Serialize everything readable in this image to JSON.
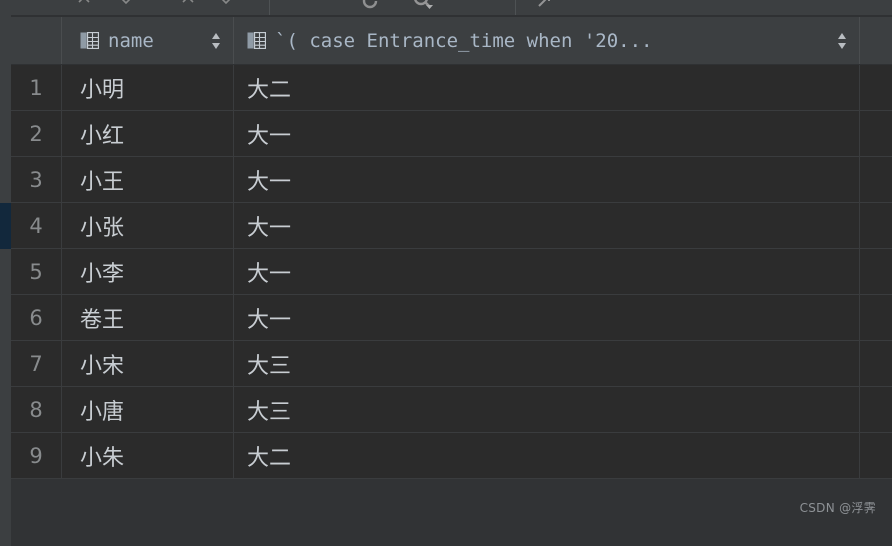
{
  "window": {
    "theme_background": "#2b2b2b",
    "panel_background": "#313335",
    "header_background": "#3c3f41",
    "accent_selection": "#12283c",
    "text_color": "#a9b7c6"
  },
  "toolbar": {
    "icons": [
      {
        "name": "chevron-collapse-icon",
        "glyph": ""
      },
      {
        "name": "chevron-expand-icon",
        "glyph": ""
      },
      {
        "name": "refresh-icon",
        "glyph": ""
      },
      {
        "name": "search-filter-icon",
        "glyph": ""
      },
      {
        "name": "minimize-icon",
        "glyph": ""
      },
      {
        "name": "open-in-editor-icon",
        "glyph": ""
      }
    ]
  },
  "grid": {
    "row_number_header": "",
    "columns": [
      {
        "key": "name",
        "label": "name",
        "icon": "table-column-icon",
        "sortable": true,
        "sort_state": "none"
      },
      {
        "key": "expr",
        "label": "`( case Entrance_time when '20...",
        "icon": "table-column-icon",
        "sortable": true,
        "sort_state": "none"
      }
    ],
    "rows": [
      {
        "n": "1",
        "name": "小明",
        "expr": "大二",
        "selected": false
      },
      {
        "n": "2",
        "name": "小红",
        "expr": "大一",
        "selected": false
      },
      {
        "n": "3",
        "name": "小王",
        "expr": "大一",
        "selected": false
      },
      {
        "n": "4",
        "name": "小张",
        "expr": "大一",
        "selected": true
      },
      {
        "n": "5",
        "name": "小李",
        "expr": "大一",
        "selected": false
      },
      {
        "n": "6",
        "name": "卷王",
        "expr": "大一",
        "selected": false
      },
      {
        "n": "7",
        "name": "小宋",
        "expr": "大三",
        "selected": false
      },
      {
        "n": "8",
        "name": "小唐",
        "expr": "大三",
        "selected": false
      },
      {
        "n": "9",
        "name": "小朱",
        "expr": "大二",
        "selected": false
      }
    ]
  },
  "watermark": {
    "text": "CSDN @浮霁"
  }
}
